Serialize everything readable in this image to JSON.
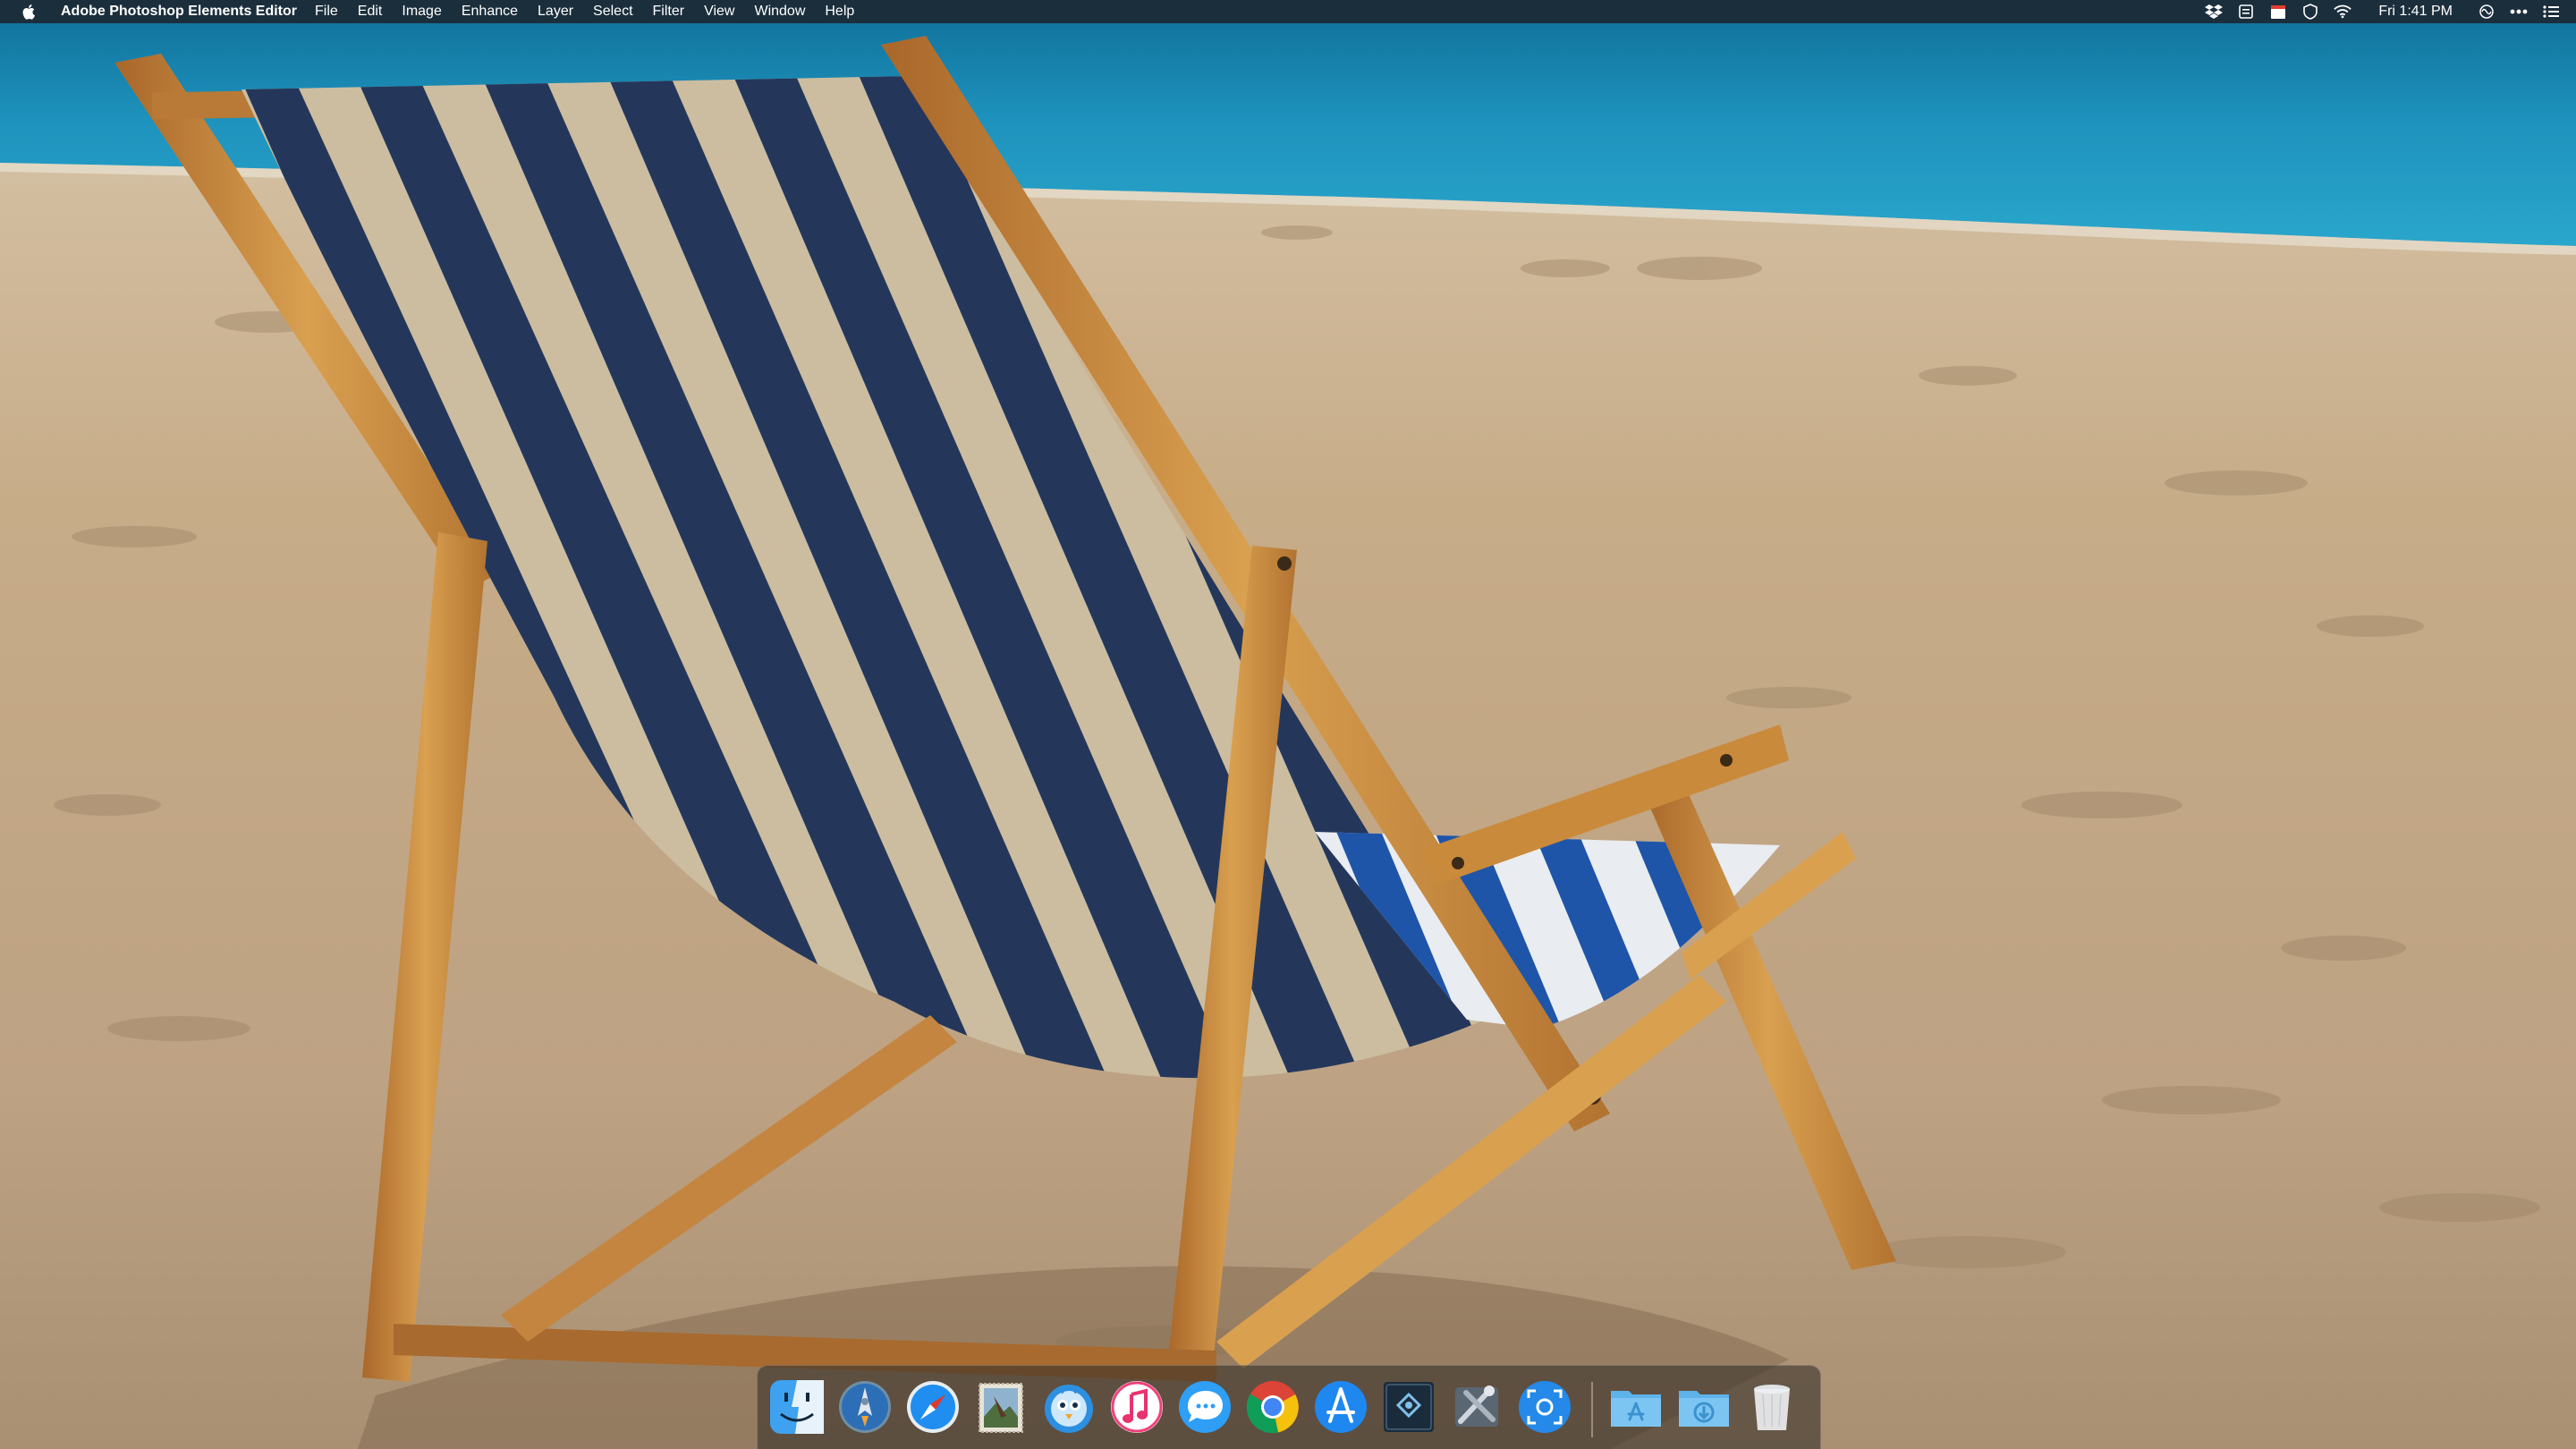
{
  "menubar": {
    "app_name": "Adobe Photoshop Elements Editor",
    "menus": [
      "File",
      "Edit",
      "Image",
      "Enhance",
      "Layer",
      "Select",
      "Filter",
      "View",
      "Window",
      "Help"
    ],
    "clock": "Fri 1:41 PM",
    "status_icons": [
      "dropbox-icon",
      "document-icon",
      "calendar-icon",
      "shield-icon",
      "wifi-icon",
      "siri-icon",
      "more-icon",
      "notification-center-icon"
    ]
  },
  "wallpaper": {
    "subject": "striped beach chair on sand",
    "colors": {
      "sea": "#1f8fb8",
      "sand": "#c9b08e",
      "stripe_dark": "#1f3a6b",
      "stripe_light": "#d9cbb2",
      "wood": "#c98a3c"
    }
  },
  "dock": {
    "apps": [
      {
        "name": "Finder",
        "icon": "finder-icon",
        "running": true
      },
      {
        "name": "Launchpad",
        "icon": "launchpad-icon",
        "running": true
      },
      {
        "name": "Safari",
        "icon": "safari-icon",
        "running": true
      },
      {
        "name": "Mail",
        "icon": "mail-stamp-icon",
        "running": false
      },
      {
        "name": "Tweetbot",
        "icon": "bird-icon",
        "running": true
      },
      {
        "name": "iTunes",
        "icon": "music-note-icon",
        "running": false
      },
      {
        "name": "Messages",
        "icon": "chat-bubble-icon",
        "running": true
      },
      {
        "name": "Chrome",
        "icon": "chrome-icon",
        "running": true
      },
      {
        "name": "App Store",
        "icon": "app-store-icon",
        "running": false
      },
      {
        "name": "Photoshop Elements Editor",
        "icon": "photoshop-elements-icon",
        "running": true
      },
      {
        "name": "Utilities",
        "icon": "tools-icon",
        "running": false
      },
      {
        "name": "Screenshot",
        "icon": "screenshot-icon",
        "running": false
      },
      {
        "name": "Applications",
        "icon": "applications-folder-icon",
        "running": false
      },
      {
        "name": "Downloads",
        "icon": "downloads-folder-icon",
        "running": false
      },
      {
        "name": "Trash",
        "icon": "trash-icon",
        "running": false
      }
    ]
  }
}
